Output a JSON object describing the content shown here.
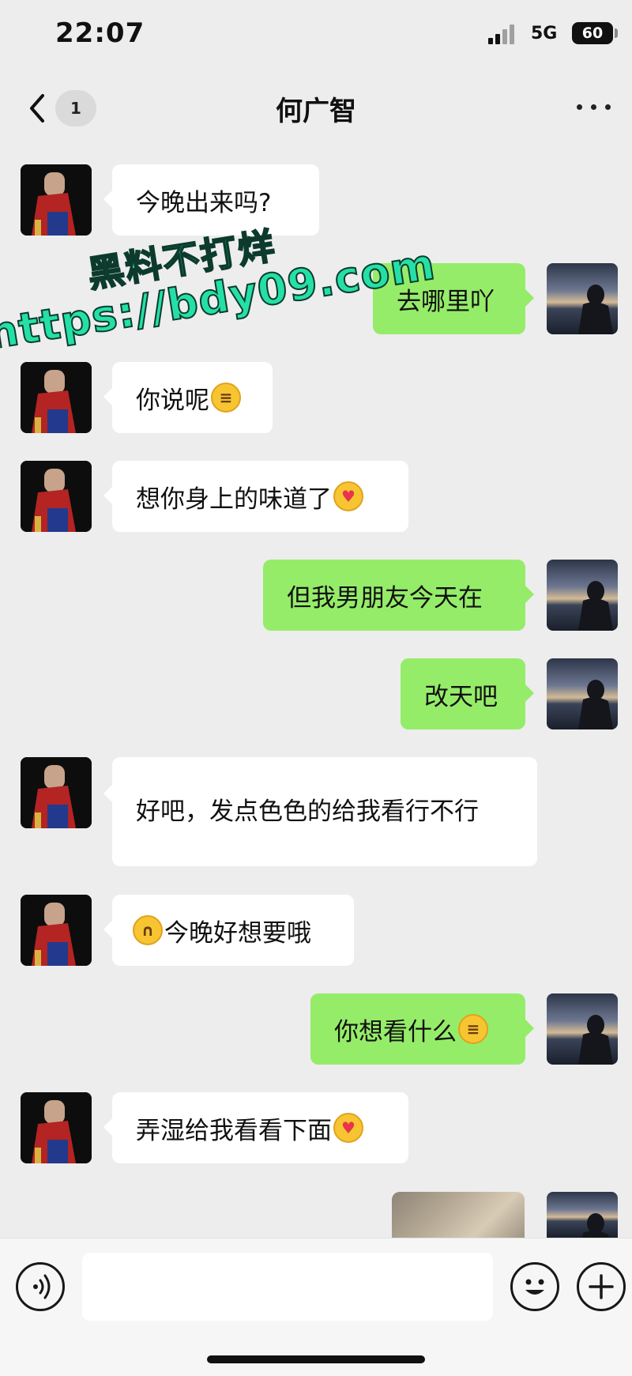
{
  "status_bar": {
    "time": "22:07",
    "network": "5G",
    "battery": "60"
  },
  "nav": {
    "unread_count": "1",
    "title": "何广智"
  },
  "watermark": {
    "line1": "黑料不打烊",
    "line2": "https://bdy09.com"
  },
  "messages": [
    {
      "side": "in",
      "text": "今晚出来吗?"
    },
    {
      "side": "out",
      "text": "去哪里吖"
    },
    {
      "side": "in",
      "text": "你说呢",
      "emoji_after": "grin-emoji"
    },
    {
      "side": "in",
      "text": "想你身上的味道了",
      "emoji_after": "heart-eyes-emoji"
    },
    {
      "side": "out",
      "text": "但我男朋友今天在"
    },
    {
      "side": "out",
      "text": "改天吧"
    },
    {
      "side": "in",
      "text": "好吧，发点色色的给我看行不行"
    },
    {
      "side": "in",
      "text": "今晚好想要哦",
      "emoji_before": "pouting-emoji"
    },
    {
      "side": "out",
      "text": "你想看什么",
      "emoji_after": "grin-squint-emoji"
    },
    {
      "side": "in",
      "text": "弄湿给我看看下面",
      "emoji_after": "heart-eyes-drool-emoji"
    },
    {
      "side": "out",
      "type": "image"
    }
  ],
  "input": {
    "value": ""
  },
  "icons": {
    "back": "chevron-left-icon",
    "more": "more-dots-icon",
    "voice": "voice-icon",
    "emoji": "emoji-icon",
    "plus": "plus-icon"
  },
  "colors": {
    "outgoing_bubble": "#95ec69",
    "incoming_bubble": "#ffffff",
    "background": "#ededed",
    "watermark": "#25e0a6"
  }
}
